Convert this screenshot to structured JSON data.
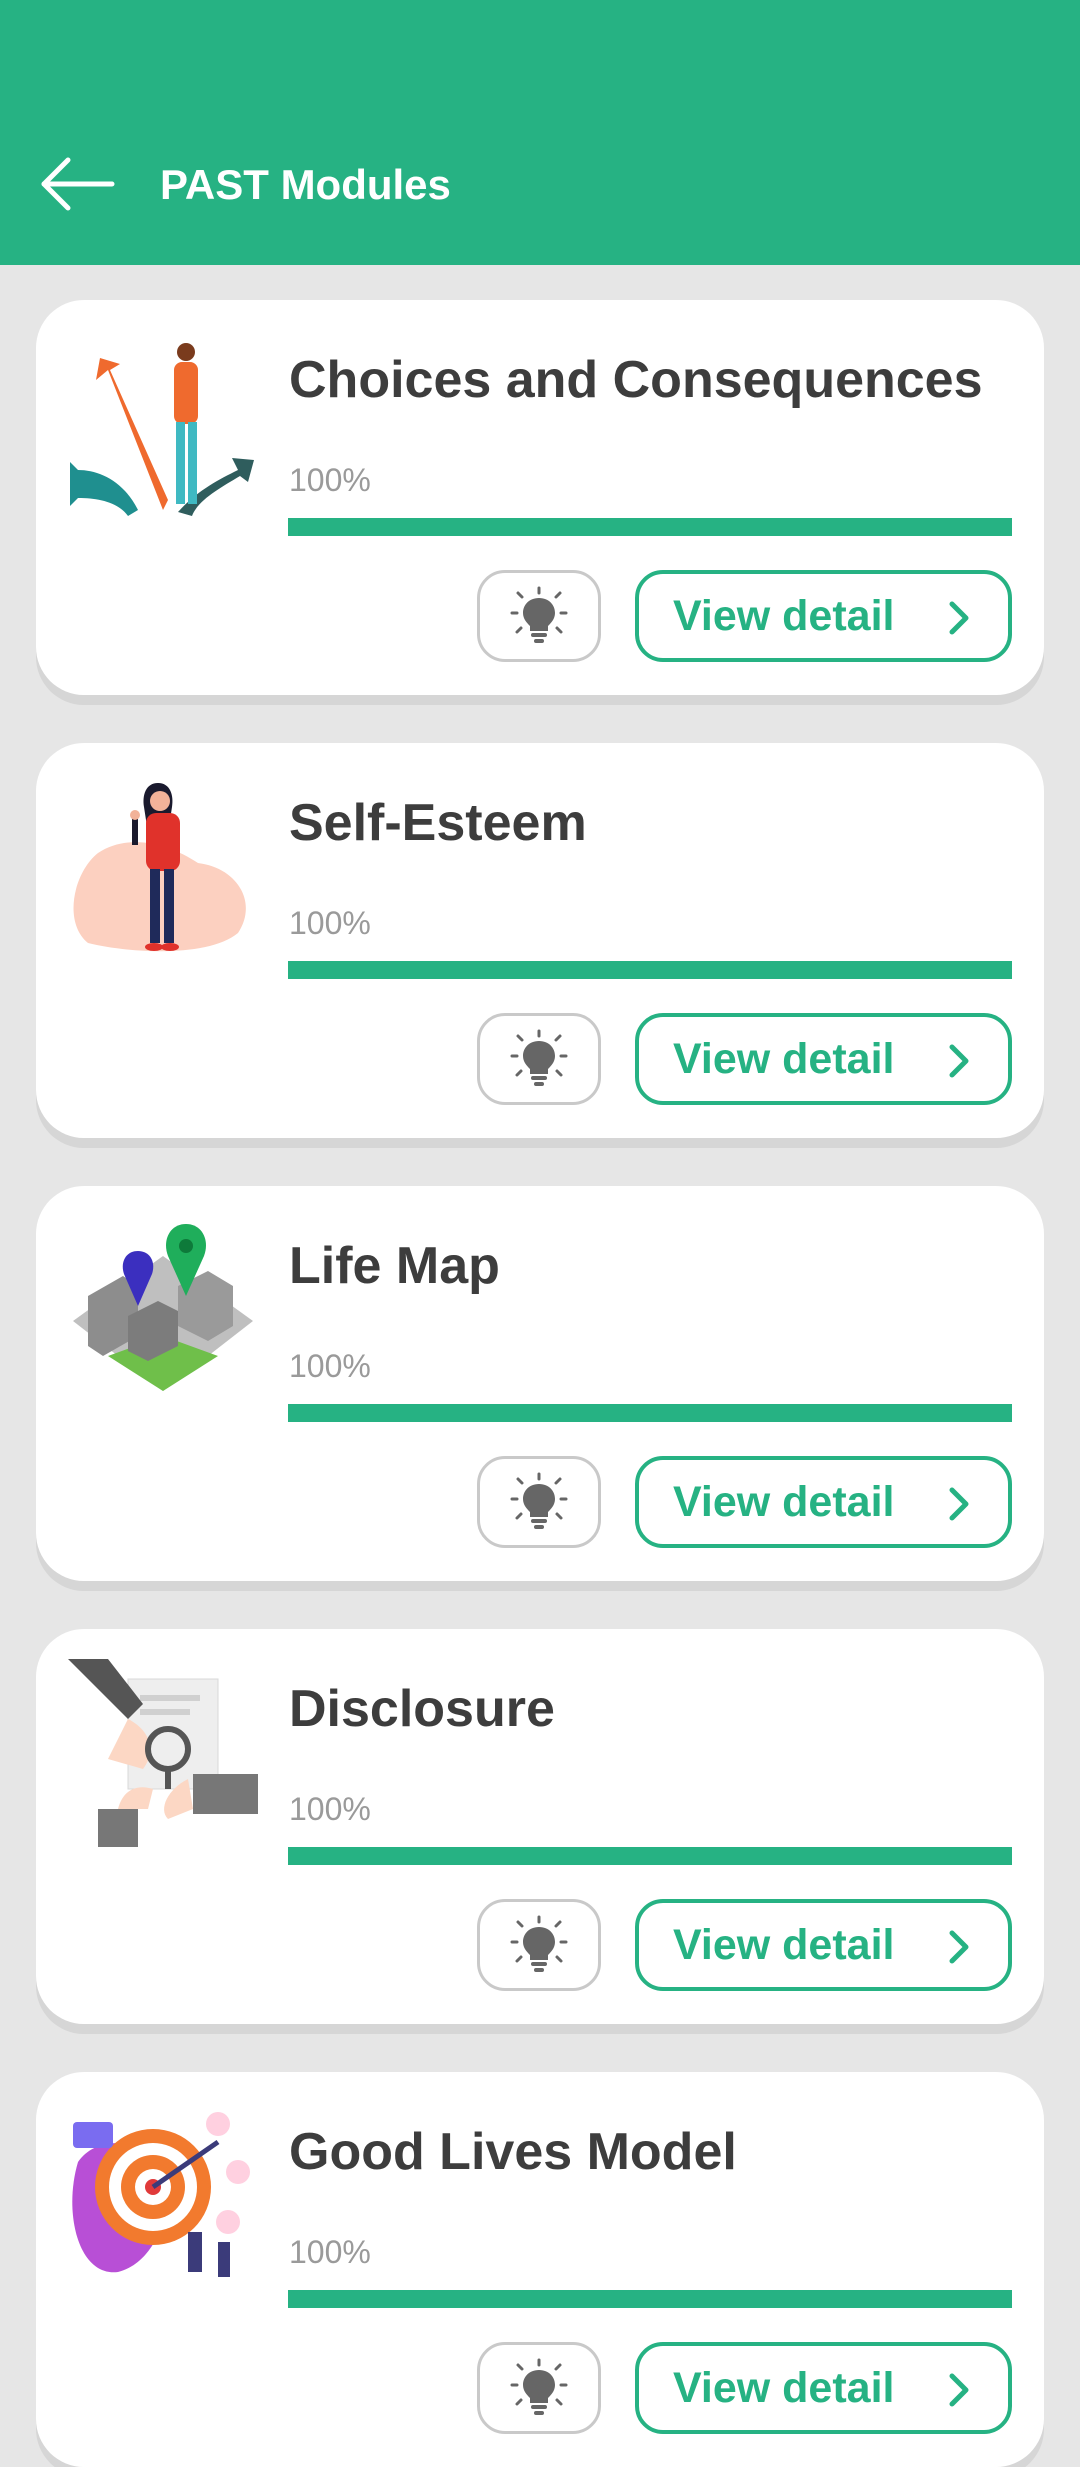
{
  "header": {
    "title": "PAST Modules",
    "back_icon": "arrow-left-icon"
  },
  "colors": {
    "accent": "#26b283",
    "background": "#e6e6e6",
    "title_text": "#3d3d3d",
    "muted_text": "#9a9a9a"
  },
  "modules": [
    {
      "title": "Choices and Consequences",
      "progress_label": "100%",
      "progress": 1.0,
      "hint_icon": "lightbulb-icon",
      "detail_label": "View detail",
      "detail_icon": "chevron-right-icon"
    },
    {
      "title": "Self-Esteem",
      "progress_label": "100%",
      "progress": 1.0,
      "hint_icon": "lightbulb-icon",
      "detail_label": "View detail",
      "detail_icon": "chevron-right-icon"
    },
    {
      "title": "Life Map",
      "progress_label": "100%",
      "progress": 1.0,
      "hint_icon": "lightbulb-icon",
      "detail_label": "View detail",
      "detail_icon": "chevron-right-icon"
    },
    {
      "title": "Disclosure",
      "progress_label": "100%",
      "progress": 1.0,
      "hint_icon": "lightbulb-icon",
      "detail_label": "View detail",
      "detail_icon": "chevron-right-icon"
    },
    {
      "title": "Good Lives Model",
      "progress_label": "100%",
      "progress": 1.0,
      "hint_icon": "lightbulb-icon",
      "detail_label": "View detail",
      "detail_icon": "chevron-right-icon"
    }
  ]
}
